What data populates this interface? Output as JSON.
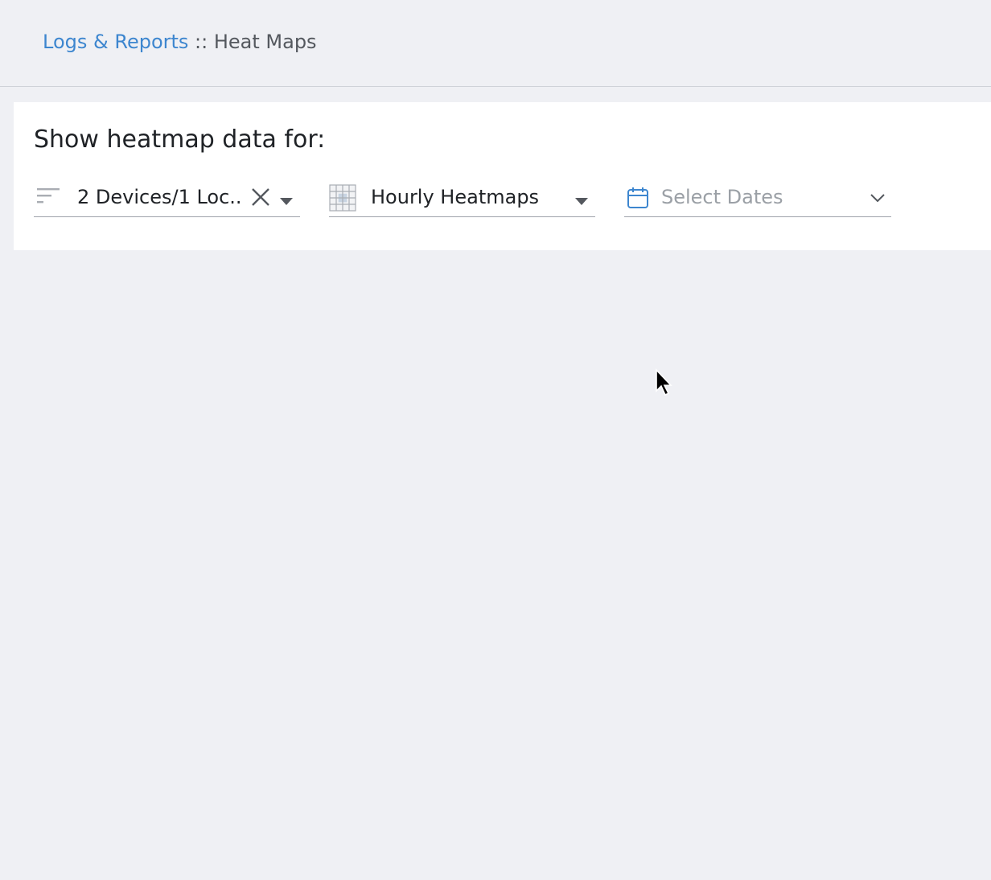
{
  "breadcrumb": {
    "parent_label": "Logs & Reports",
    "separator": " :: ",
    "current_label": "Heat Maps"
  },
  "filters": {
    "title": "Show heatmap data for:",
    "devices": {
      "value": "2 Devices/1 Loc...",
      "icon": "filter-list-icon",
      "clear_icon": "close-icon",
      "toggle_icon": "caret-down-icon"
    },
    "heatmap_type": {
      "value": "Hourly Heatmaps",
      "icon": "grid-icon",
      "toggle_icon": "caret-down-icon"
    },
    "dates": {
      "placeholder": "Select Dates",
      "icon": "calendar-icon",
      "toggle_icon": "chevron-down-icon"
    }
  },
  "colors": {
    "background": "#eff0f4",
    "panel": "#ffffff",
    "link": "#3d86cf",
    "text": "#1f2226",
    "muted": "#9ba0a6",
    "accent_icon": "#3d86cf"
  }
}
